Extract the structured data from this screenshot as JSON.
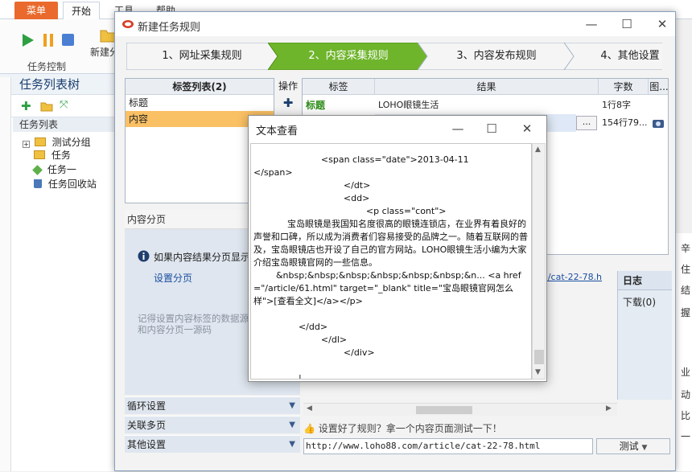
{
  "app": {
    "tabs": {
      "menu": "菜单",
      "start": "开始",
      "tools": "工具",
      "help": "帮助"
    },
    "ribbon": {
      "task_control_caption": "任务控制",
      "new_label": "新建分"
    },
    "side": {
      "title": "任务列表树",
      "list_header": "任务列表",
      "tree": [
        "测试分组",
        "任务",
        "任务一",
        "任务回收站"
      ]
    },
    "right_strip": [
      "辛",
      "住",
      "结",
      "握",
      "业",
      "动",
      "比",
      "一"
    ]
  },
  "dialog": {
    "title": "新建任务规则",
    "steps": [
      "1、网址采集规则",
      "2、内容采集规则",
      "3、内容发布规则",
      "4、其他设置"
    ],
    "tag_list": {
      "header": "标签列表(2)",
      "items": [
        "标题",
        "内容"
      ]
    },
    "ops_header": "操作",
    "grid": {
      "headers": [
        "标签",
        "结果",
        "字数",
        "图..."
      ],
      "rows": [
        {
          "tag": "标题",
          "result": "LOHO眼镜生活",
          "count": "1行8字"
        },
        {
          "tag": "内容",
          "result": "",
          "more": "...",
          "count": "154行79..."
        }
      ]
    },
    "paging": {
      "title": "内容分页",
      "info": "如果内容结果分页显示",
      "link": "设置分页",
      "hint": "记得设置内容标签的数据源，在默认页和内容分页一源码"
    },
    "accordion": [
      "循环设置",
      "关联多页",
      "其他设置"
    ],
    "log": {
      "title": "日志",
      "download": "下载(0)"
    },
    "link_peek": "le/cat-22-78.h",
    "test_hint": "设置好了规则？拿一个内容页面测试一下！",
    "test_url": "http://www.loho88.com/article/cat-22-78.html",
    "test_button": "测试"
  },
  "viewer": {
    "title": "文本查看",
    "content": "                        <span class=\"date\">2013-04-11\n</span>\n                                </dt>\n                                <dd>\n                                        <p class=\"cont\">\n            宝岛眼镜是我国知名度很高的眼镜连锁店，在业界有着良好的声誉和口碑，所以成为消费者们容易接受的品牌之一。随着互联网的普及，宝岛眼镜店也开设了自己的官方网站。LOHO眼镜生活小编为大家介绍宝岛眼镜官网的一些信息。\n        &nbsp;&nbsp;&nbsp;&nbsp;&nbsp;&nbsp;&n... <a href=\"/article/61.html\" target=\"_blank\" title=\"宝岛眼镜官网怎么样\">[查看全文]</a></p>\n\n                </dd>\n                        </dl>\n                                </div>\n\n                |"
  }
}
